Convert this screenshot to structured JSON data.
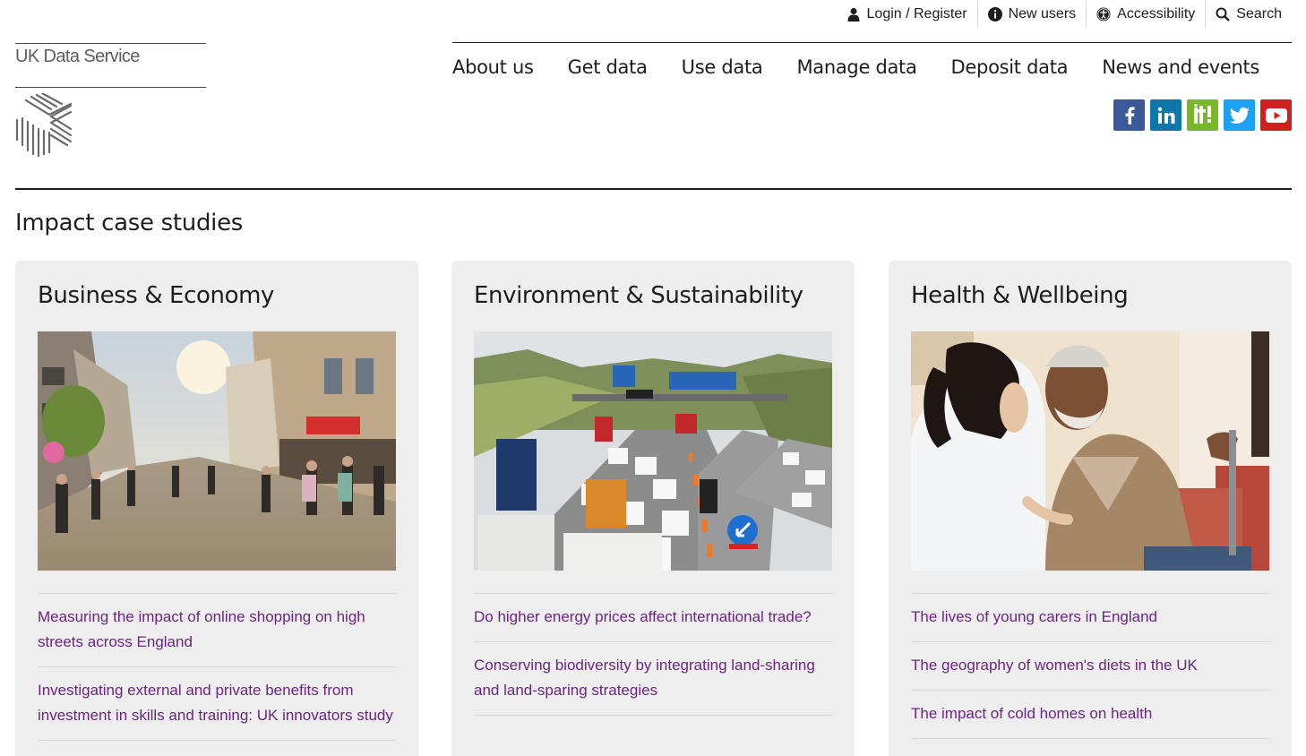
{
  "utility": {
    "login": "Login / Register",
    "new_users": "New users",
    "accessibility": "Accessibility",
    "search": "Search"
  },
  "logo": {
    "text": "UK Data Service"
  },
  "nav": [
    "About us",
    "Get data",
    "Use data",
    "Manage data",
    "Deposit data",
    "News and events"
  ],
  "social": [
    {
      "name": "facebook",
      "color": "#3b5998",
      "icon": "facebook-icon"
    },
    {
      "name": "linkedin",
      "color": "#0e76a8",
      "icon": "linkedin-icon"
    },
    {
      "name": "iti",
      "color": "#76b82a",
      "icon": "iti-icon"
    },
    {
      "name": "twitter",
      "color": "#1da1f2",
      "icon": "twitter-icon"
    },
    {
      "name": "youtube",
      "color": "#cd201f",
      "icon": "youtube-icon"
    }
  ],
  "page_title": "Impact case studies",
  "cards": [
    {
      "title": "Business & Economy",
      "image": "high-street-photo",
      "links": [
        "Measuring the impact of online shopping on high streets across England",
        "Investigating external and private benefits from investment in skills and training: UK innovators study"
      ]
    },
    {
      "title": "Environment & Sustainability",
      "image": "motorway-traffic-photo",
      "links": [
        "Do higher energy prices affect international trade?",
        "Conserving biodiversity by integrating land-sharing and land-sparing strategies"
      ]
    },
    {
      "title": "Health & Wellbeing",
      "image": "carer-and-elderly-man-photo",
      "links": [
        "The lives of young carers in England",
        "The geography of women's diets in the UK",
        "The impact of cold homes on health"
      ]
    }
  ],
  "colors": {
    "link": "#6b2581",
    "card_bg": "#eeeeee",
    "text": "#1d1d1b"
  }
}
